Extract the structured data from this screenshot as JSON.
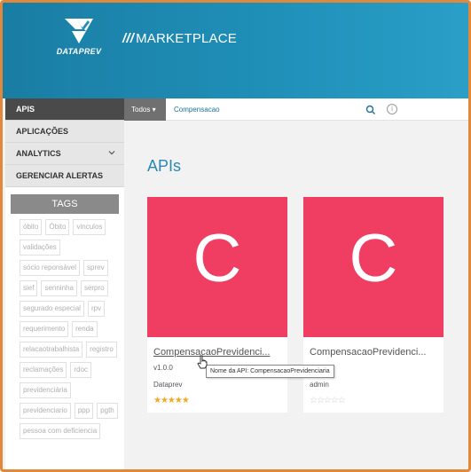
{
  "header": {
    "logo_text": "DATAPREV",
    "title_slashes": "///",
    "title": "MARKETPLACE"
  },
  "sidebar": {
    "items": [
      {
        "label": "APIS",
        "active": true
      },
      {
        "label": "APLICAÇÕES"
      },
      {
        "label": "ANALYTICS",
        "chevron": "chevron-down-icon"
      },
      {
        "label": "GERENCIAR ALERTAS"
      }
    ],
    "tags_title": "TAGS",
    "tags": [
      "óbito",
      "Óbito",
      "vinculos",
      "validações",
      "sócio reponsável",
      "sprev",
      "sief",
      "senninha",
      "serpro",
      "segurado especial",
      "rpv",
      "requerimento",
      "renda",
      "relacaotrabalhista",
      "registro",
      "reclamações",
      "rdoc",
      "previdenciária",
      "previdenciario",
      "ppp",
      "pgth",
      "pessoa com deficiencia"
    ]
  },
  "search": {
    "scope_label": "Todos ▾",
    "query": "Compensacao",
    "search_icon": "search-icon",
    "info_icon": "info-icon"
  },
  "main": {
    "title": "APIs",
    "cards": [
      {
        "letter": "C",
        "name": "CompensacaoPrevidenci...",
        "version": "v1.0.0",
        "owner": "Dataprev",
        "stars": "★★★★★",
        "rating": 5
      },
      {
        "letter": "C",
        "name": "CompensacaoPrevidenci...",
        "version": "",
        "owner": "admin",
        "stars": "☆☆☆☆☆",
        "rating": 0
      }
    ],
    "tooltip": "Nome da API: CompensacaoPrevidenciaria"
  },
  "colors": {
    "banner": "#1f8fb8",
    "card_bg": "#ef3e61",
    "title": "#2a89b2",
    "star": "#f5a623",
    "frame": "#e0893a"
  }
}
